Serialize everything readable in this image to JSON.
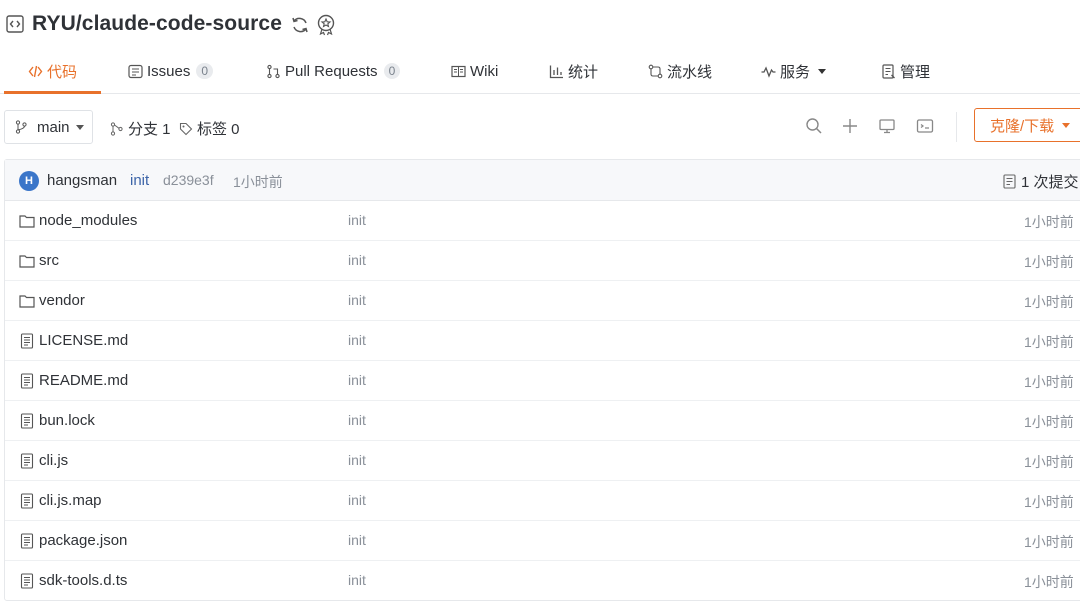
{
  "repo": {
    "title": "RYU/claude-code-source"
  },
  "tabs": [
    {
      "label": "代码",
      "icon": "code-icon",
      "active": true
    },
    {
      "label": "Issues",
      "icon": "issues-icon",
      "count": "0"
    },
    {
      "label": "Pull Requests",
      "icon": "pull-request-icon",
      "count": "0"
    },
    {
      "label": "Wiki",
      "icon": "wiki-icon"
    },
    {
      "label": "统计",
      "icon": "stats-icon"
    },
    {
      "label": "流水线",
      "icon": "pipeline-icon"
    },
    {
      "label": "服务",
      "icon": "service-icon"
    },
    {
      "label": "管理",
      "icon": "manage-icon"
    }
  ],
  "toolbar": {
    "branch": "main",
    "branches_label": "分支 1",
    "tags_label": "标签 0",
    "clone_label": "克隆/下载"
  },
  "commit": {
    "avatar_letter": "H",
    "author": "hangsman",
    "message": "init",
    "hash": "d239e3f",
    "time": "1小时前",
    "count_label": "1 次提交"
  },
  "files": [
    {
      "name": "node_modules",
      "type": "folder",
      "message": "init",
      "time": "1小时前"
    },
    {
      "name": "src",
      "type": "folder",
      "message": "init",
      "time": "1小时前"
    },
    {
      "name": "vendor",
      "type": "folder",
      "message": "init",
      "time": "1小时前"
    },
    {
      "name": "LICENSE.md",
      "type": "file",
      "message": "init",
      "time": "1小时前"
    },
    {
      "name": "README.md",
      "type": "file",
      "message": "init",
      "time": "1小时前"
    },
    {
      "name": "bun.lock",
      "type": "file",
      "message": "init",
      "time": "1小时前"
    },
    {
      "name": "cli.js",
      "type": "file",
      "message": "init",
      "time": "1小时前"
    },
    {
      "name": "cli.js.map",
      "type": "file",
      "message": "init",
      "time": "1小时前"
    },
    {
      "name": "package.json",
      "type": "file",
      "message": "init",
      "time": "1小时前"
    },
    {
      "name": "sdk-tools.d.ts",
      "type": "file",
      "message": "init",
      "time": "1小时前"
    }
  ],
  "colors": {
    "accent": "#e8712b",
    "link": "#3c64a8",
    "muted": "#8a9099"
  }
}
